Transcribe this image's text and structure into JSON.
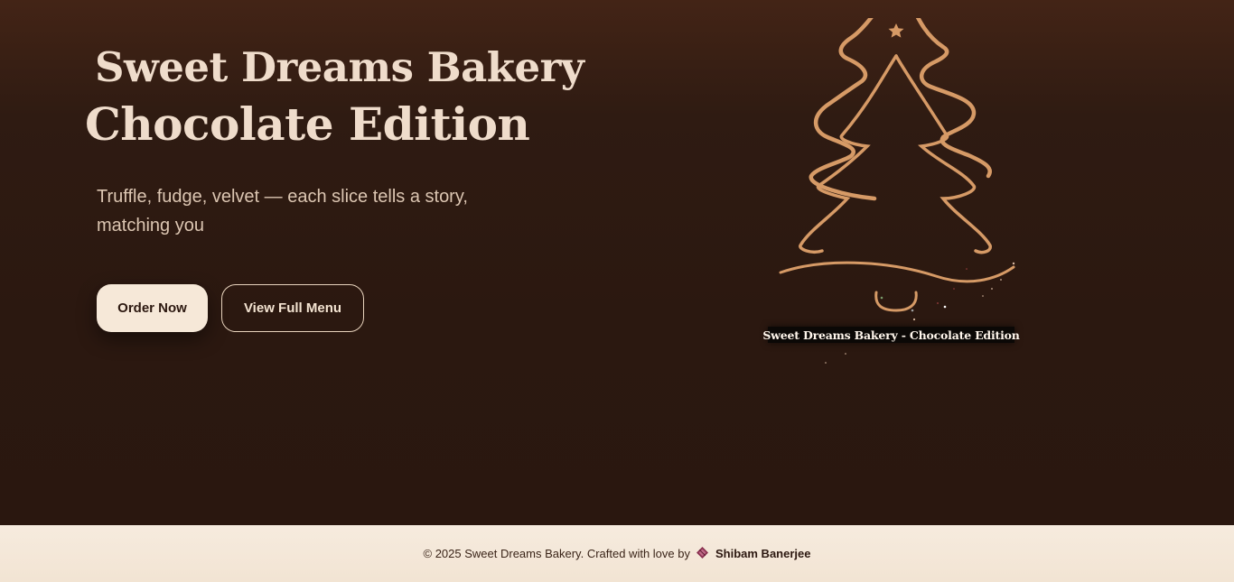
{
  "hero": {
    "title_line_1": "Sweet Dreams Bakery",
    "title_line_2": "Chocolate Edition",
    "subtitle": "Truffle, fudge, velvet — each slice tells a story, matching you",
    "order_button": "Order Now",
    "menu_button": "View Full Menu"
  },
  "tree": {
    "caption": "Sweet Dreams Bakery - Chocolate Edition",
    "icon": "christmas-tree-icon",
    "star_icon": "star-icon",
    "line_color": "#d69a66"
  },
  "footer": {
    "copyright": "© 2025 Sweet Dreams Bakery. Crafted with love by",
    "icon": "chocolate-icon",
    "author": "Shibam Banerjee"
  },
  "colors": {
    "background": "#2c1810",
    "title": "#efdccb",
    "button_primary_bg": "#f6e8d8",
    "footer_bg": "#f6ebde"
  }
}
